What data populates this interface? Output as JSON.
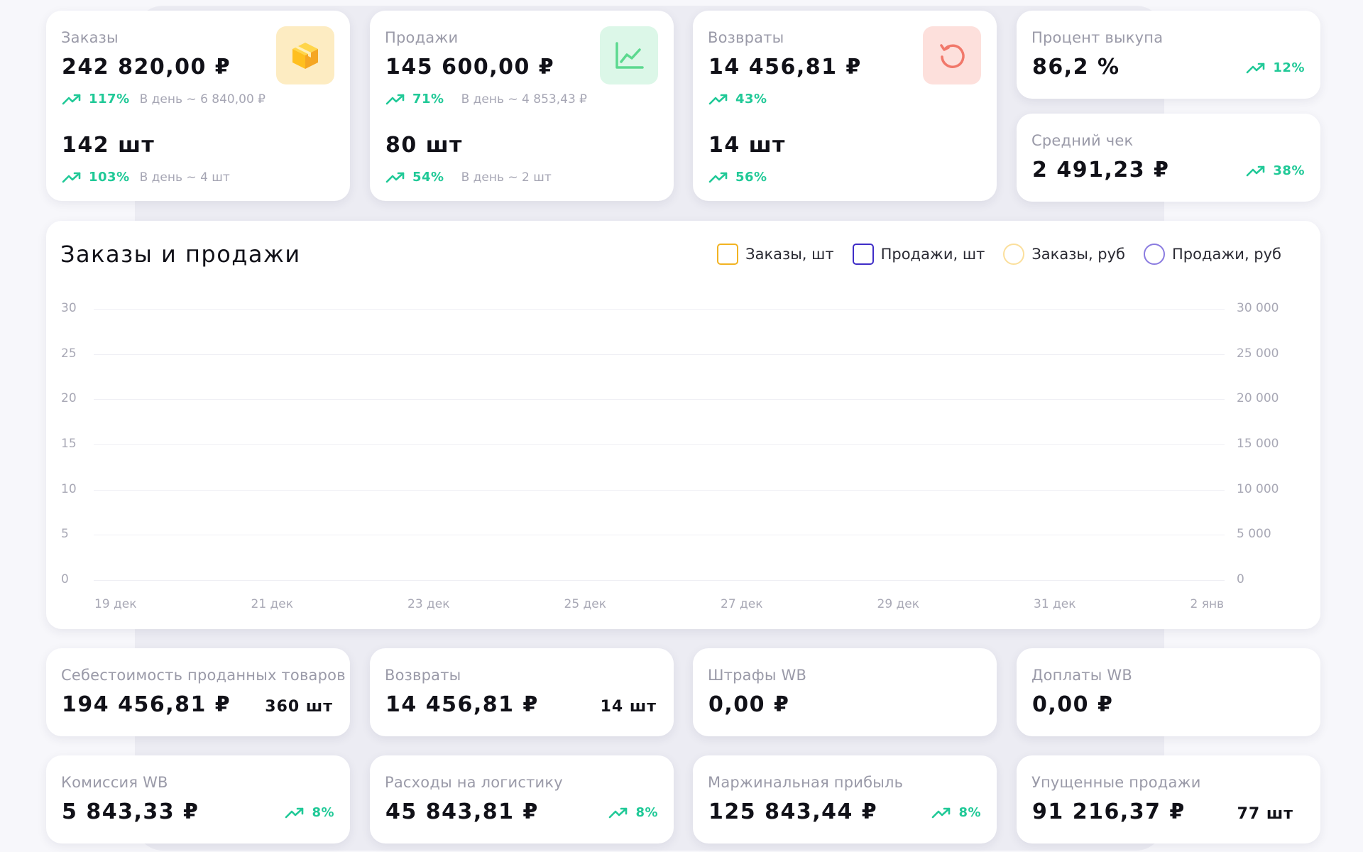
{
  "colors": {
    "accent_green": "#20c997",
    "orders_tile": "#fdecc2",
    "sales_tile": "#dcf7e8",
    "returns_tile": "#fde0dc",
    "legend_orders_qty": "#f2b322",
    "legend_sales_qty": "#3f2dc7",
    "legend_orders_rub": "#fbdf9c",
    "legend_sales_rub": "#8a7be0"
  },
  "kpi": {
    "orders": {
      "label": "Заказы",
      "amount": "242 820,00 ₽",
      "amount_trend": "117%",
      "amount_per_day": "В день ~ 6 840,00 ₽",
      "qty": "142 шт",
      "qty_trend": "103%",
      "qty_per_day": "В день ~ 4 шт",
      "icon": "box-icon"
    },
    "sales": {
      "label": "Продажи",
      "amount": "145 600,00 ₽",
      "amount_trend": "71%",
      "amount_per_day": "В день ~ 4 853,43 ₽",
      "qty": "80 шт",
      "qty_trend": "54%",
      "qty_per_day": "В день ~ 2 шт",
      "icon": "line-chart-icon"
    },
    "returns": {
      "label": "Возвраты",
      "amount": "14 456,81 ₽",
      "amount_trend": "43%",
      "qty": "14 шт",
      "qty_trend": "56%",
      "icon": "refresh-icon"
    },
    "buyout": {
      "label": "Процент выкупа",
      "value": "86,2 %",
      "trend": "12%"
    },
    "avg_check": {
      "label": "Средний чек",
      "value": "2 491,23 ₽",
      "trend": "38%"
    }
  },
  "chart": {
    "title": "Заказы и продажи",
    "legend": [
      {
        "label": "Заказы, шт",
        "shape": "square"
      },
      {
        "label": "Продажи, шт",
        "shape": "square"
      },
      {
        "label": "Заказы, руб",
        "shape": "circle"
      },
      {
        "label": "Продажи, руб",
        "shape": "circle"
      }
    ]
  },
  "chart_data": {
    "type": "line",
    "title": "Заказы и продажи",
    "x": [
      "19 дек",
      "21 дек",
      "23 дек",
      "25 дек",
      "27 дек",
      "29 дек",
      "31 дек",
      "2 янв"
    ],
    "y_left_ticks": [
      "30",
      "25",
      "20",
      "15",
      "10",
      "5",
      "0"
    ],
    "y_right_ticks": [
      "30 000",
      "25 000",
      "20 000",
      "15 000",
      "10 000",
      "5 000",
      "0"
    ],
    "ylim_left": [
      0,
      30
    ],
    "ylim_right": [
      0,
      30000
    ],
    "grid": true,
    "legend_position": "top-right",
    "series": [
      {
        "name": "Заказы, шт",
        "axis": "left",
        "values": []
      },
      {
        "name": "Продажи, шт",
        "axis": "left",
        "values": []
      },
      {
        "name": "Заказы, руб",
        "axis": "right",
        "values": []
      },
      {
        "name": "Продажи, руб",
        "axis": "right",
        "values": []
      }
    ]
  },
  "bottom": {
    "cogs": {
      "label": "Себестоимость проданных товаров",
      "value": "194 456,81 ₽",
      "qty": "360 шт"
    },
    "returns": {
      "label": "Возвраты",
      "value": "14 456,81 ₽",
      "qty": "14 шт"
    },
    "fines": {
      "label": "Штрафы WB",
      "value": "0,00 ₽"
    },
    "surcharges": {
      "label": "Доплаты WB",
      "value": "0,00 ₽"
    },
    "commission": {
      "label": "Комиссия WB",
      "value": "5 843,33 ₽",
      "trend": "8%"
    },
    "logistics": {
      "label": "Расходы на логистику",
      "value": "45 843,81 ₽",
      "trend": "8%"
    },
    "margin": {
      "label": "Маржинальная прибыль",
      "value": "125 843,44 ₽",
      "trend": "8%"
    },
    "lost_sales": {
      "label": "Упущенные продажи",
      "value": "91 216,37 ₽",
      "qty": "77 шт"
    }
  }
}
